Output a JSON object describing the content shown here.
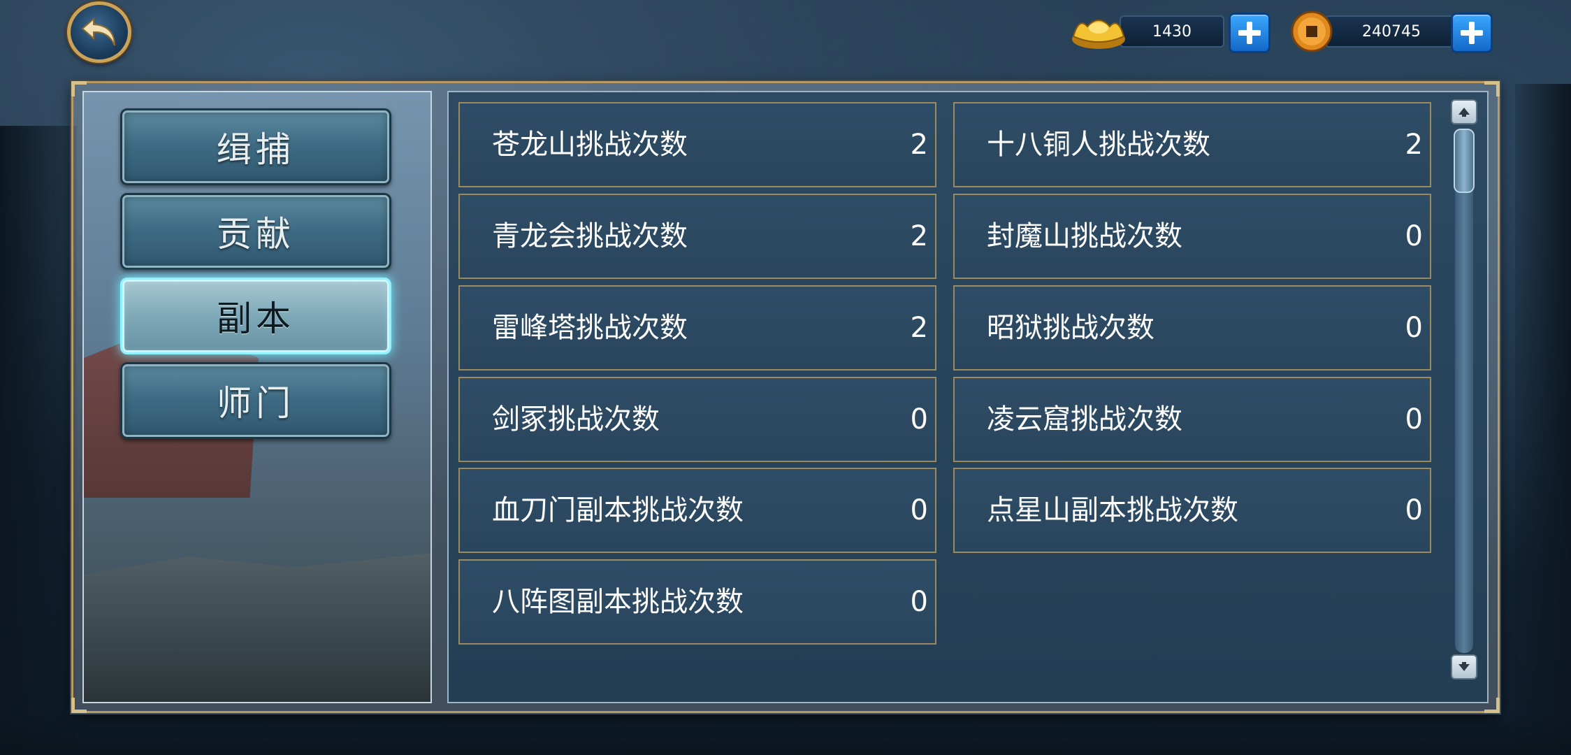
{
  "currency": {
    "gold_ingot": {
      "value": "1430",
      "icon": "gold-ingot-icon"
    },
    "copper_coin": {
      "value": "240745",
      "icon": "copper-coin-icon"
    }
  },
  "tabs": [
    {
      "label": "缉捕",
      "active": false
    },
    {
      "label": "贡献",
      "active": false
    },
    {
      "label": "副本",
      "active": true
    },
    {
      "label": "师门",
      "active": false
    }
  ],
  "entries": {
    "left": [
      {
        "label": "苍龙山挑战次数",
        "value": "2"
      },
      {
        "label": "青龙会挑战次数",
        "value": "2"
      },
      {
        "label": "雷峰塔挑战次数",
        "value": "2"
      },
      {
        "label": "剑冢挑战次数",
        "value": "0"
      },
      {
        "label": "血刀门副本挑战次数",
        "value": "0"
      },
      {
        "label": "八阵图副本挑战次数",
        "value": "0"
      }
    ],
    "right": [
      {
        "label": "十八铜人挑战次数",
        "value": "2"
      },
      {
        "label": "封魔山挑战次数",
        "value": "0"
      },
      {
        "label": "昭狱挑战次数",
        "value": "0"
      },
      {
        "label": "凌云窟挑战次数",
        "value": "0"
      },
      {
        "label": "点星山副本挑战次数",
        "value": "0"
      }
    ]
  },
  "colors": {
    "active_tab_glow": "#6ff0ff",
    "cell_border": "#9a8a5e",
    "plus_button": "#1e88e5"
  }
}
